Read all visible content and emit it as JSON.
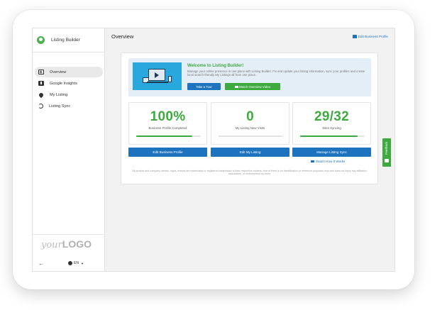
{
  "app": {
    "name": "Listing Builder"
  },
  "sidebar": {
    "items": [
      {
        "label": "Overview",
        "icon": "overview-icon",
        "active": true
      },
      {
        "label": "Google Insights",
        "icon": "insights-icon",
        "active": false
      },
      {
        "label": "My Listing",
        "icon": "location-pin-icon",
        "active": false
      },
      {
        "label": "Listing Sync",
        "icon": "sync-icon",
        "active": false
      }
    ],
    "logo_your": "your",
    "logo_logo": "LOGO",
    "language": "EN"
  },
  "header": {
    "title": "Overview",
    "edit_profile_label": "Edit Business Profile"
  },
  "welcome": {
    "title": "Welcome to Listing Builder!",
    "text": "Manage your online presence in one place with Listing Builder. Fix and update your listing information, sync your profiles and create local search-friendly My Listings all from one place.",
    "tour_label": "Take a Tour",
    "video_label": "Watch Overview Video"
  },
  "stats": [
    {
      "value": "100%",
      "label": "Business Profile Completed",
      "progress": 0.87
    },
    {
      "value": "0",
      "label": "My Listing New Visits",
      "progress": 0.0
    },
    {
      "value": "29/32",
      "label": "Sites Syncing",
      "progress": 0.89
    }
  ],
  "actions": [
    {
      "label": "Edit Business Profile"
    },
    {
      "label": "Edit My Listing"
    },
    {
      "label": "Manage Listing Sync"
    }
  ],
  "how_it_works_label": "Watch How It Works",
  "disclaimer": "All product and company names, logos, brands are trademarks or registered trademarks of their respective holders. Use of them is for identification or reference purposes only and does not imply any affiliation, association, or endorsement by them.",
  "feedback_label": "Feedback",
  "colors": {
    "accent_green": "#3daa3f",
    "accent_blue": "#1e73be",
    "banner_bg": "#e4eef7"
  }
}
